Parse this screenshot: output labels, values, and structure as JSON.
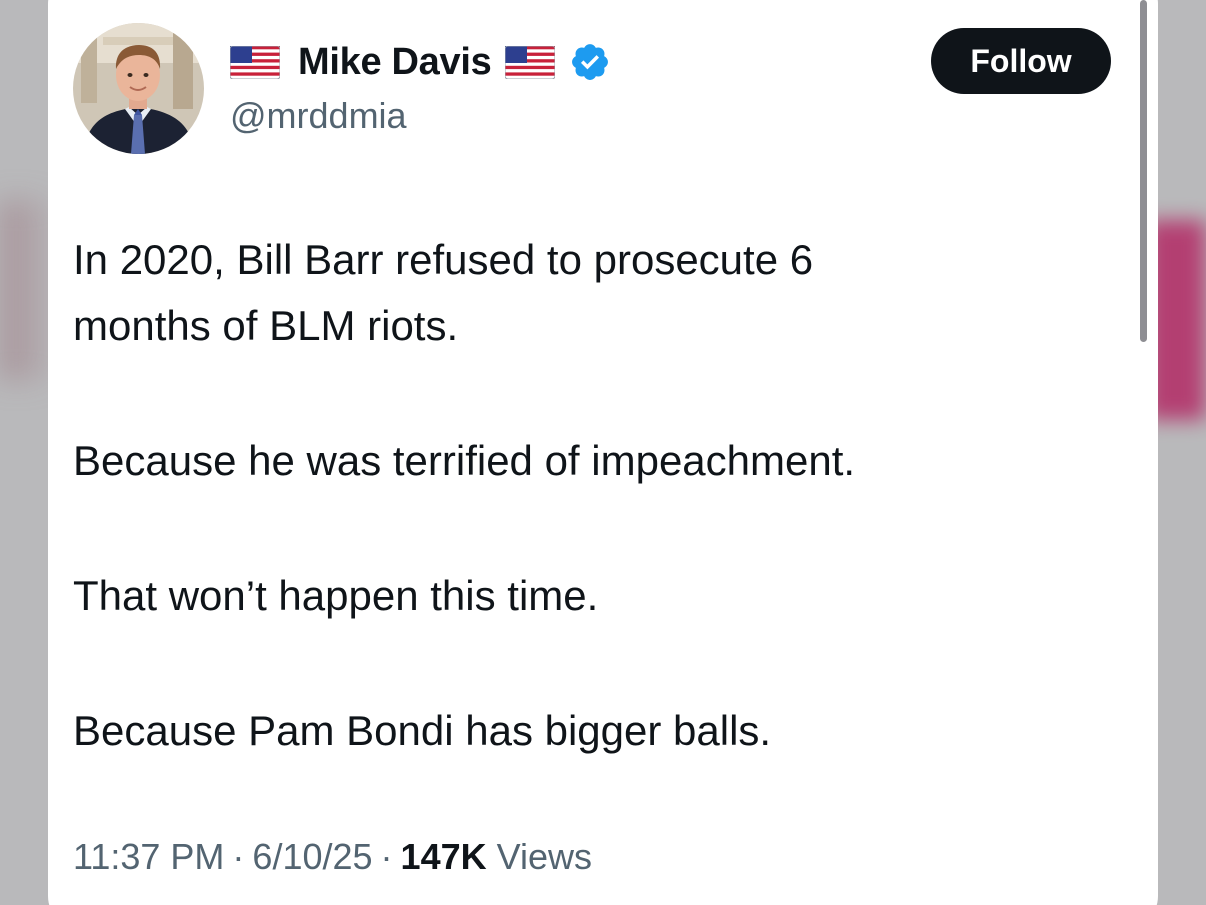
{
  "author": {
    "display_name": "Mike Davis",
    "handle": "@mrddmia",
    "verified": true,
    "flag_icon": "us-flag-icon",
    "verified_icon": "verified-badge-icon",
    "verified_color": "#1d9bf0"
  },
  "follow_button": {
    "label": "Follow"
  },
  "tweet": {
    "paragraphs": [
      "In 2020, Bill Barr refused to prosecute 6\nmonths of BLM riots.",
      "Because he was terrified of impeachment.",
      "That won’t happen this time.",
      "Because Pam Bondi has bigger balls."
    ]
  },
  "meta": {
    "time": "11:37 PM",
    "separator": "·",
    "date": "6/10/25",
    "views_count": "147K",
    "views_label": "Views"
  },
  "colors": {
    "text_primary": "#0f1419",
    "text_secondary": "#536471",
    "button_bg": "#0f1419",
    "button_text": "#ffffff"
  }
}
